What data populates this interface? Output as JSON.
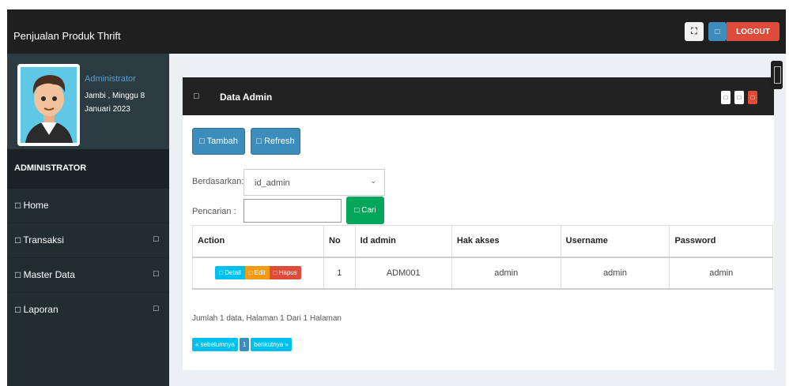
{
  "app": {
    "title": "Penjualan Produk Thrift"
  },
  "topbar": {
    "expand_icon": "⛶",
    "blue_icon": "□",
    "logout_label": "LOGOUT"
  },
  "user": {
    "name": "Administrator",
    "line1": "Jambi , Minggu 8",
    "line2": "Januari 2023"
  },
  "sidebar": {
    "header": "ADMINISTRATOR",
    "items": [
      {
        "label": "□ Home",
        "arrow": ""
      },
      {
        "label": "□ Transaksi",
        "arrow": "□"
      },
      {
        "label": "□ Master Data",
        "arrow": "□"
      },
      {
        "label": "□ Laporan",
        "arrow": "□"
      }
    ]
  },
  "box": {
    "icon": "□",
    "title": "Data Admin",
    "hdr_btn1": "□",
    "hdr_btn2": "□",
    "hdr_btn3": "□"
  },
  "actions": {
    "tambah": "□ Tambah",
    "refresh": "□ Refresh"
  },
  "filter": {
    "by_label": "Berdasarkan:",
    "by_value": "id_admin",
    "search_label": "Pencarian   :",
    "search_value": "",
    "cari": "□ Cari"
  },
  "table": {
    "headers": [
      "Action",
      "No",
      "Id admin",
      "Hak akses",
      "Username",
      "Password"
    ],
    "rows": [
      {
        "detail": "□ Detail",
        "edit": "□ Edit",
        "hapus": "□ Hapus",
        "no": "1",
        "id_admin": "ADM001",
        "hak_akses": "admin",
        "username": "admin",
        "password": "admin"
      }
    ]
  },
  "summary": "Jumlah 1 data, Halaman 1 Dari 1 Halaman",
  "pager": {
    "prev": "« sebelumnya",
    "current": "1",
    "next": "berikutnya »"
  },
  "colors": {
    "logout": "#dd4b39",
    "primary": "#3c8dbc",
    "success": "#00a65a",
    "info": "#00c0ef",
    "warning": "#f39c12",
    "sidebar": "#222d32"
  }
}
